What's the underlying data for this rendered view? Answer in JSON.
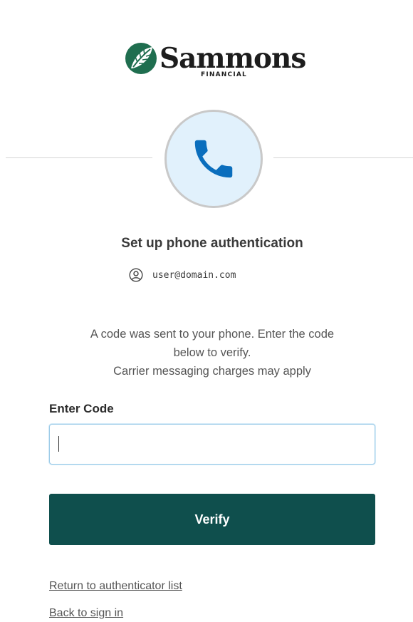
{
  "logo": {
    "name": "Sammons",
    "sub": "FINANCIAL",
    "brand_green": "#1f6e4f"
  },
  "auth": {
    "icon": "phone-icon",
    "icon_color": "#0a6ebd",
    "title": "Set up phone authentication",
    "user_email": "user@domain.com"
  },
  "message": {
    "line1": "A code was sent to your phone. Enter the code",
    "line2": "below to verify.",
    "line3": "Carrier messaging charges may apply"
  },
  "form": {
    "code_label": "Enter Code",
    "code_value": "",
    "verify_label": "Verify",
    "button_color": "#0f4f4d"
  },
  "links": {
    "return_label": "Return to authenticator list",
    "back_label": "Back to sign in"
  }
}
